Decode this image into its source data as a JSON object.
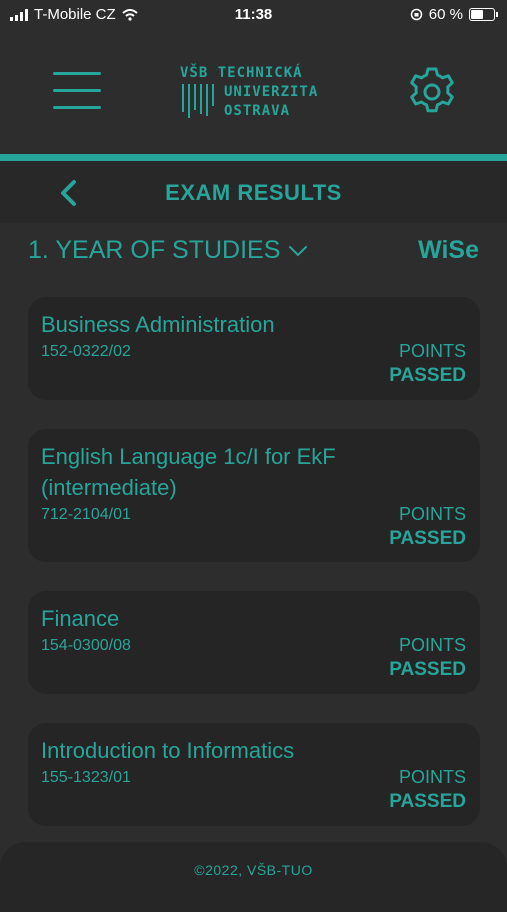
{
  "status_bar": {
    "carrier": "T-Mobile CZ",
    "time": "11:38",
    "battery_percent": "60 %",
    "battery_level": 0.6
  },
  "header": {
    "logo_line1": "VŠB TECHNICKÁ",
    "logo_line2": "UNIVERZITA",
    "logo_line3": "OSTRAVA",
    "menu_icon": "hamburger-icon",
    "settings_icon": "gear-icon"
  },
  "titlebar": {
    "title": "EXAM RESULTS",
    "back_icon": "chevron-left-icon"
  },
  "filter": {
    "year": "1. YEAR OF STUDIES",
    "semester": "WiSe"
  },
  "courses": [
    {
      "name_line1": "Business Administration",
      "name_line2": "",
      "code": "152-0322/02",
      "points": "POINTS",
      "status": "PASSED"
    },
    {
      "name_line1": "English Language 1c/I for EkF",
      "name_line2": "(intermediate)",
      "code": "712-2104/01",
      "points": "POINTS",
      "status": "PASSED"
    },
    {
      "name_line1": "Finance",
      "name_line2": "",
      "code": "154-0300/08",
      "points": "POINTS",
      "status": "PASSED"
    },
    {
      "name_line1": "Introduction to Informatics",
      "name_line2": "",
      "code": "155-1323/01",
      "points": "POINTS",
      "status": "PASSED"
    }
  ],
  "footer": {
    "copyright": "©2022, VŠB-TUO"
  },
  "colors": {
    "accent": "#26a69a",
    "background": "#2d2d2d",
    "card": "#252525"
  }
}
